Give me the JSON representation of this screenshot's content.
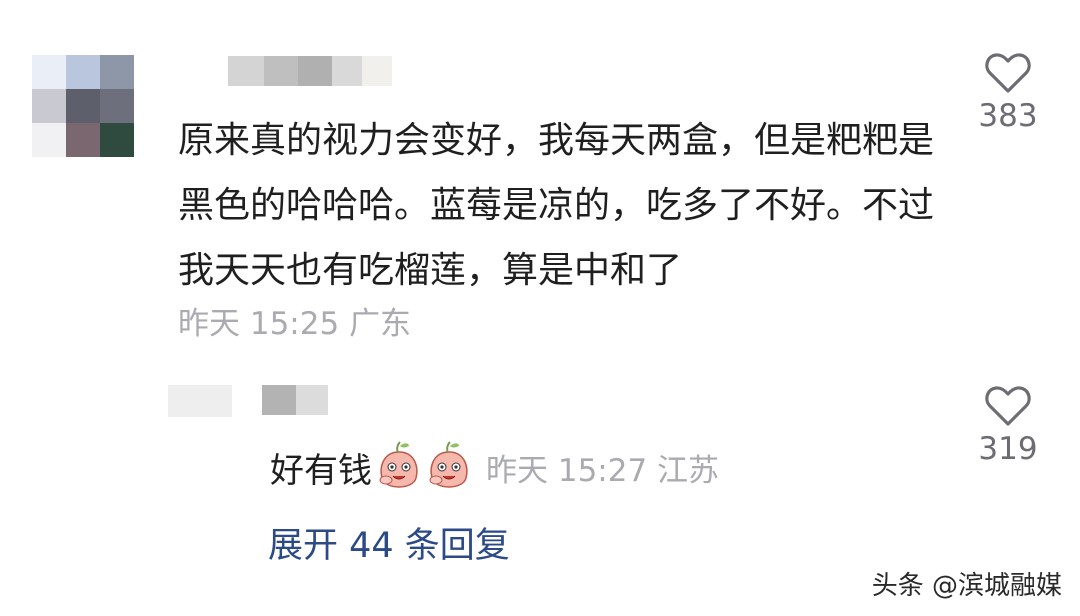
{
  "comment": {
    "text": "原来真的视力会变好，我每天两盒，但是粑粑是黑色的哈哈哈。蓝莓是凉的，吃多了不好。不过我天天也有吃榴莲，算是中和了",
    "time": "昨天 15:25",
    "location": "广东",
    "like_count": "383"
  },
  "reply": {
    "text": "好有钱",
    "emoji": "laughing-peach-emoji",
    "time": "昨天 15:27",
    "location": "江苏",
    "like_count": "319"
  },
  "expand_replies": "展开 44 条回复",
  "watermark": "头条 @滨城融媒",
  "colors": {
    "link": "#2b4a86",
    "meta": "#a9abb0",
    "text": "#1f1f1f"
  }
}
